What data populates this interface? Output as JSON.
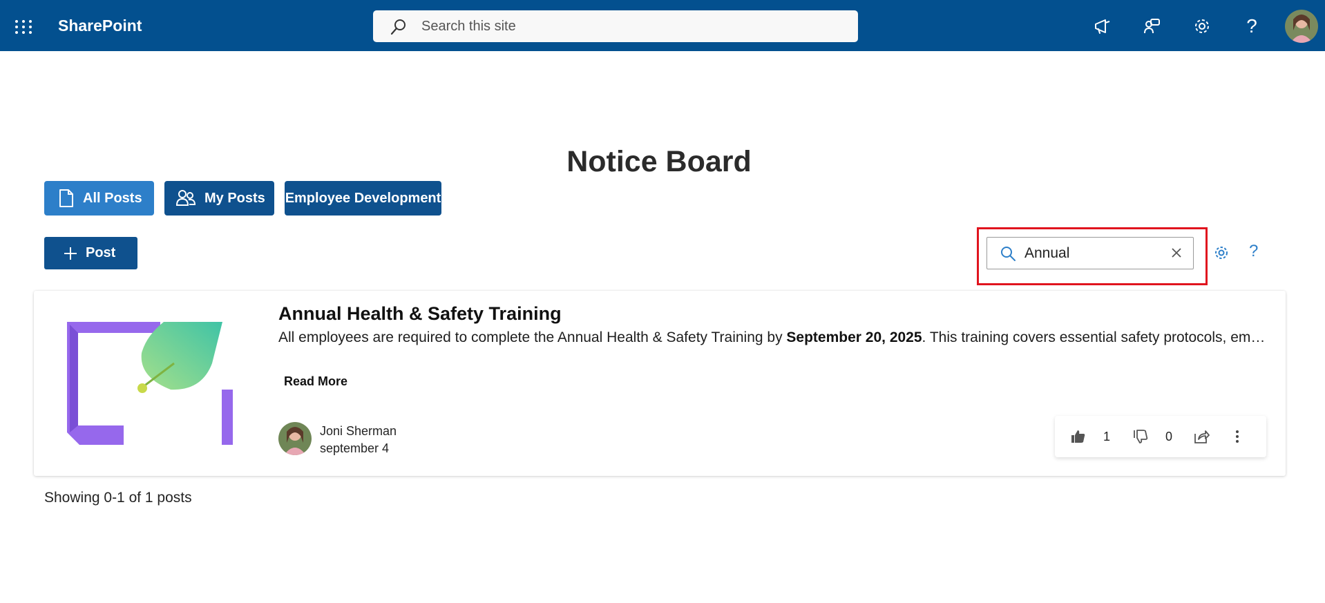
{
  "suite_bar": {
    "app_name": "SharePoint",
    "search_placeholder": "Search this site",
    "bg_color": "#03508f",
    "icons": [
      "app-launcher-icon",
      "megaphone-icon",
      "feedback-icon",
      "gear-icon",
      "help-icon",
      "avatar"
    ],
    "help_label": "?"
  },
  "page": {
    "title": "Notice Board"
  },
  "tabs": [
    {
      "label": "All Posts",
      "icon": "document-icon",
      "active": true
    },
    {
      "label": "My Posts",
      "icon": "people-icon",
      "active": false
    },
    {
      "label": "Employee Development",
      "icon": "",
      "active": false
    }
  ],
  "toolbar": {
    "post_label": "Post",
    "filter_value": "Annual",
    "help_label": "?"
  },
  "post": {
    "title": "Annual Health & Safety Training",
    "body_prefix": "All employees are required to complete the Annual Health & Safety Training by ",
    "body_bold": "September 20, 2025",
    "body_suffix": ". This training covers essential safety protocols, emergency procedures, and workplace wellness practices.",
    "read_more": "Read More",
    "author": "Joni Sherman",
    "date": "september 4",
    "likes": "1",
    "dislikes": "0"
  },
  "footer": {
    "showing": "Showing 0-1 of 1 posts"
  },
  "colors": {
    "accent": "#2d7fc9",
    "dark_blue": "#0f518e",
    "highlight": "#e0141e"
  }
}
